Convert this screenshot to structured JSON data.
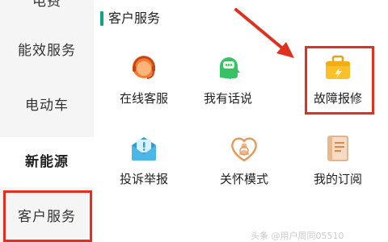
{
  "sidebar": {
    "items": [
      {
        "label": "电费"
      },
      {
        "label": "能效服务"
      },
      {
        "label": "电动车"
      },
      {
        "label": "新能源"
      },
      {
        "label": "客户服务"
      }
    ]
  },
  "section": {
    "title": "客户服务"
  },
  "services": [
    {
      "label": "在线客服",
      "icon": "customer-service-headset-icon",
      "color": "#f26b2a"
    },
    {
      "label": "我有话说",
      "icon": "speech-bubble-head-icon",
      "color": "#3cc36a"
    },
    {
      "label": "故障报修",
      "icon": "repair-toolbox-icon",
      "color": "#f7b51c"
    },
    {
      "label": "投诉举报",
      "icon": "complaint-envelope-icon",
      "color": "#2aa3d8"
    },
    {
      "label": "关怀模式",
      "icon": "care-heart-icon",
      "color": "#e8a56a"
    },
    {
      "label": "我的订阅",
      "icon": "subscription-book-icon",
      "color": "#e0a679"
    }
  ],
  "colors": {
    "accent": "#12a383",
    "highlight": "#e0301e"
  },
  "watermark": "头条 @用户周同05510"
}
